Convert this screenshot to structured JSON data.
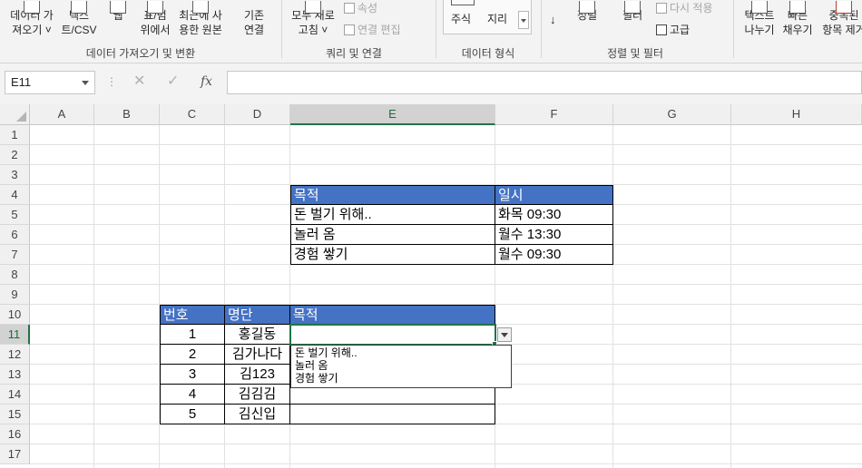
{
  "ribbon": {
    "get_data": [
      "데이터 가",
      "져오기 ˅"
    ],
    "text_csv": [
      "텍스",
      "트/CSV"
    ],
    "web": "웹",
    "from_table": [
      "표/범",
      "위에서"
    ],
    "recent_sources": [
      "최근에 사",
      "용한 원본"
    ],
    "existing_connections": [
      "기존",
      "연결"
    ],
    "group_get_transform": "데이터 가져오기 및 변환",
    "refresh_all": [
      "모두 새로",
      "고침 ˅"
    ],
    "properties": "속성",
    "edit_links": "연결 편집",
    "group_queries": "쿼리 및 연결",
    "stocks": "주식",
    "geography": "지리",
    "group_data_types": "데이터 형식",
    "sort_az": "↓",
    "sort": "정렬",
    "filter": "필터",
    "reapply": "다시 적용",
    "advanced": "고급",
    "group_sort_filter": "정렬 및 필터",
    "text_to_columns": [
      "텍스트",
      "나누기"
    ],
    "flash_fill": [
      "빠른",
      "채우기"
    ],
    "remove_duplicates": [
      "중복된",
      "항목 제거"
    ]
  },
  "formula_bar": {
    "name_box": "E11",
    "menu_dots": "⋮",
    "cancel": "✕",
    "enter": "✓",
    "fx": "fx",
    "formula": ""
  },
  "sheet": {
    "columns": [
      "A",
      "B",
      "C",
      "D",
      "E",
      "F",
      "G",
      "H"
    ],
    "rows": [
      "1",
      "2",
      "3",
      "4",
      "5",
      "6",
      "7",
      "8",
      "9",
      "10",
      "11",
      "12",
      "13",
      "14",
      "15",
      "16",
      "17"
    ],
    "active_cell": "E11",
    "purpose_table": {
      "headers": [
        "목적",
        "일시"
      ],
      "rows": [
        [
          "돈 벌기 위해..",
          "화목 09:30"
        ],
        [
          "놀러 옴",
          "월수 13:30"
        ],
        [
          "경험 쌓기",
          "월수 09:30"
        ]
      ]
    },
    "roster_table": {
      "headers": [
        "번호",
        "명단",
        "목적"
      ],
      "rows": [
        [
          "1",
          "홍길동",
          ""
        ],
        [
          "2",
          "김가나다",
          ""
        ],
        [
          "3",
          "김123",
          ""
        ],
        [
          "4",
          "김김김",
          ""
        ],
        [
          "5",
          "김신입",
          ""
        ]
      ]
    },
    "validation_dropdown": {
      "options": [
        "돈 벌기 위해..",
        "놀러 옴",
        "경험 쌓기"
      ]
    }
  },
  "colors": {
    "header_fill": "#4472c4",
    "selection_accent": "#217346"
  }
}
